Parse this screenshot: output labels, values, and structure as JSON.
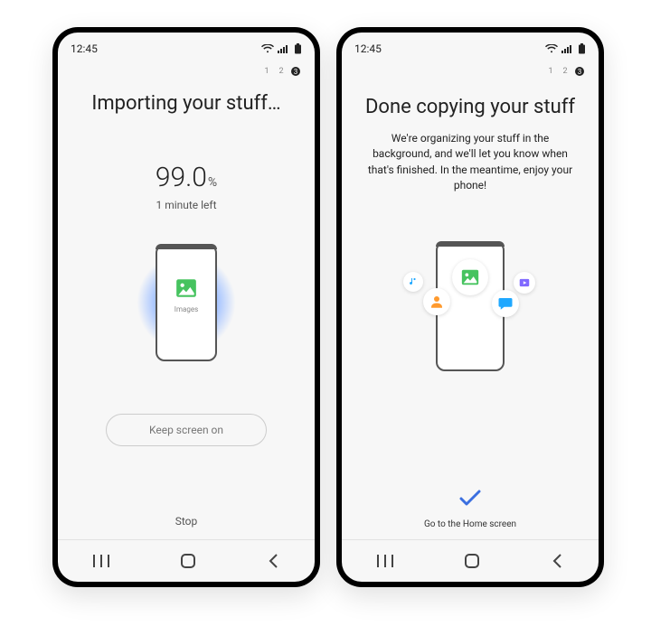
{
  "status": {
    "time": "12:45"
  },
  "steps": {
    "s1": "1",
    "s2": "2",
    "s3": "3"
  },
  "left": {
    "title": "Importing your stuff…",
    "progress": {
      "value": "99.0",
      "unit": "%",
      "subtitle": "1 minute left"
    },
    "mini_label": "Images",
    "keep_screen": "Keep screen on",
    "stop": "Stop"
  },
  "right": {
    "title": "Done copying your stuff",
    "body": "We're organizing your stuff in the background, and we'll let you know when that's finished. In the meantime, enjoy your phone!",
    "home": "Go to the Home screen"
  },
  "colors": {
    "accent": "#3b6fe0",
    "green": "#46c35f",
    "orange": "#ff9a2e",
    "chat": "#1fa8ff",
    "video": "#8069ff"
  }
}
